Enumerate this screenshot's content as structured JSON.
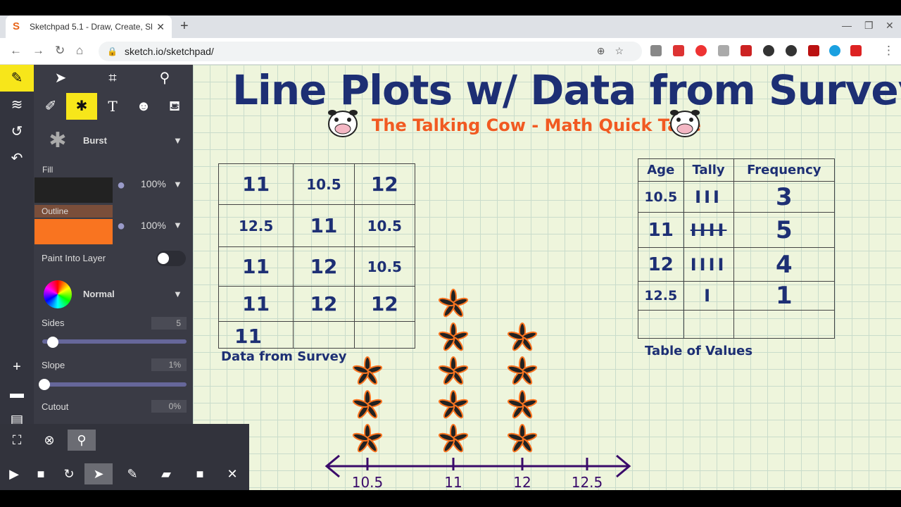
{
  "browser": {
    "tab_title": "Sketchpad 5.1 - Draw, Create, Sh",
    "tab_close": "✕",
    "new_tab": "+",
    "url": "sketch.io/sketchpad/"
  },
  "panel": {
    "brush_name": "Burst",
    "fill_label": "Fill",
    "fill_opacity": "100%",
    "outline_label": "Outline",
    "outline_opacity": "100%",
    "paint_into_layer": "Paint Into Layer",
    "blend_mode": "Normal",
    "sides_label": "Sides",
    "sides_value": "5",
    "slope_label": "Slope",
    "slope_value": "1%",
    "cutout_label": "Cutout",
    "cutout_value": "0%",
    "fill_color": "#222222",
    "outline_color": "#f97420"
  },
  "canvas": {
    "title": "Line Plots w/ Data from Surveys",
    "subtitle": "The Talking Cow - Math Quick Take",
    "survey_table": [
      [
        "11",
        "10.5",
        "12"
      ],
      [
        "12.5",
        "11",
        "10.5"
      ],
      [
        "11",
        "12",
        "10.5"
      ],
      [
        "11",
        "12",
        "12"
      ],
      [
        "11",
        "",
        ""
      ]
    ],
    "survey_caption": "Data from Survey",
    "values_headers": [
      "Age",
      "Tally",
      "Frequency"
    ],
    "values_rows": [
      [
        "10.5",
        "III",
        "3"
      ],
      [
        "11",
        "IIII",
        "5"
      ],
      [
        "12",
        "IIII",
        "4"
      ],
      [
        "12.5",
        "I",
        "1"
      ],
      [
        "",
        "",
        ""
      ]
    ],
    "values_caption": "Table of Values",
    "axis_labels": [
      "10.5",
      "11",
      "12",
      "12.5"
    ]
  },
  "chart_data": {
    "type": "scatter",
    "categories": [
      "10.5",
      "11",
      "12",
      "12.5"
    ],
    "values": [
      3,
      5,
      4,
      0
    ]
  }
}
